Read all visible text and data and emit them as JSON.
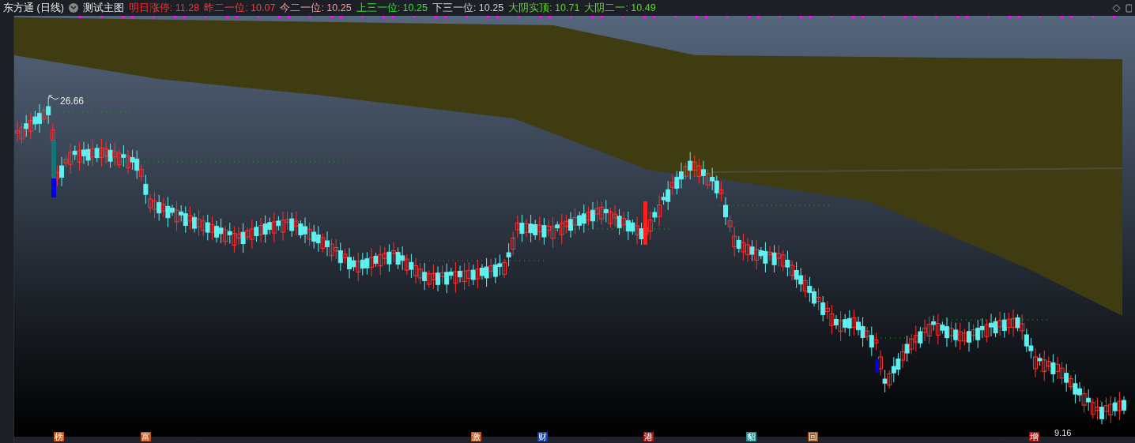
{
  "header": {
    "title": "东方通 (日线)",
    "indicator": "测试主图",
    "readings": [
      {
        "label": "明日涨停:",
        "value": "11.28",
        "color": "#ff2f2f"
      },
      {
        "label": "昨二一位:",
        "value": "10.07",
        "color": "#ff3a3a"
      },
      {
        "label": "今二一位:",
        "value": "10.25",
        "color": "#ff9a9a"
      },
      {
        "label": "上三一位:",
        "value": "10.25",
        "color": "#2ee82e"
      },
      {
        "label": "下三一位:",
        "value": "10.25",
        "color": "#d0d0d0"
      },
      {
        "label": "大阴实顶:",
        "value": "10.71",
        "color": "#5fd62a"
      },
      {
        "label": "大阴二一:",
        "value": "10.49",
        "color": "#5fd62a"
      }
    ]
  },
  "chart": {
    "high_label": "26.66",
    "low_label": "9.16"
  },
  "markers": [
    {
      "label": "榜",
      "color": "#c0561a"
    },
    {
      "label": "富",
      "color": "#c0561a"
    },
    {
      "label": "激",
      "color": "#c0561a"
    },
    {
      "label": "财",
      "color": "#1a3fa0"
    },
    {
      "label": "港",
      "color": "#a01a1a"
    },
    {
      "label": "貂",
      "color": "#1a8a8a"
    },
    {
      "label": "回",
      "color": "#a0561a"
    },
    {
      "label": "增",
      "color": "#a01a1a"
    }
  ]
}
